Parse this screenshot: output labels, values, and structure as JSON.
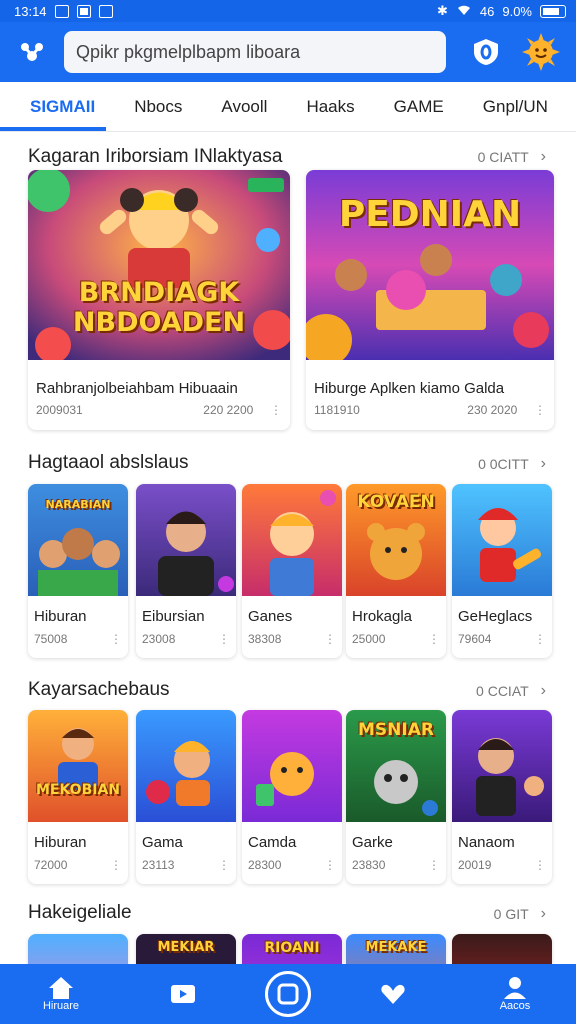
{
  "status_bar": {
    "time": "13:14",
    "battery": "9.0%",
    "signal_text": "46"
  },
  "header": {
    "search_value": "Qpikr pkgmelplbapm liboara"
  },
  "tabs": [
    "SIGMAII",
    "Nbocs",
    "Avooll",
    "Haaks",
    "GAME",
    "Gnpl/UN"
  ],
  "active_tab": 0,
  "sections": [
    {
      "title": "Kagaran Iriborsiam INlaktyasa",
      "more": "0 CIATT",
      "cards": [
        {
          "title": "Rahbranjolbeiahbam Hibuaain",
          "meta_left": "2009031",
          "meta_right": "220 2200",
          "art": "BRNDIAGK NBDOADEN"
        },
        {
          "title": "Hiburge Aplken kiamo Galda",
          "meta_left": "1181910",
          "meta_right": "230 2020",
          "art": "PEDNIAN"
        }
      ]
    },
    {
      "title": "Hagtaaol abslslaus",
      "more": "0 0CITT",
      "cards": [
        {
          "title": "Hiburan",
          "meta": "75008",
          "art": "NARABIAN"
        },
        {
          "title": "Eibursian",
          "meta": "23008",
          "art": ""
        },
        {
          "title": "Ganes",
          "meta": "38308",
          "art": ""
        },
        {
          "title": "Hrokagla",
          "meta": "25000",
          "art": "KOVAEN"
        },
        {
          "title": "GeHeglacs",
          "meta": "79604",
          "art": ""
        }
      ]
    },
    {
      "title": "Kayarsachebaus",
      "more": "0 CCIAT",
      "cards": [
        {
          "title": "Hiburan",
          "meta": "72000",
          "art": "MEKOBIAN"
        },
        {
          "title": "Gama",
          "meta": "23113",
          "art": ""
        },
        {
          "title": "Camda",
          "meta": "28300",
          "art": ""
        },
        {
          "title": "Garke",
          "meta": "23830",
          "art": "MSNIAR"
        },
        {
          "title": "Nanaom",
          "meta": "20019",
          "art": ""
        }
      ]
    },
    {
      "title": "Hakeigeliale",
      "more": "0 GIT",
      "cards": [
        {
          "art": ""
        },
        {
          "art": "MEKIAR"
        },
        {
          "art": "RIOANI"
        },
        {
          "art": "MEKAKE"
        },
        {
          "art": ""
        }
      ]
    }
  ],
  "bottom_nav": {
    "home_label": "Hiruare",
    "profile_label": "Aacos"
  },
  "colors": {
    "brand": "#1a6cf0",
    "status": "#1565e8"
  }
}
